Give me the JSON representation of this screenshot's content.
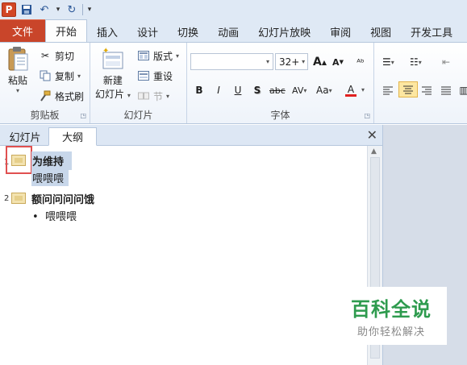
{
  "quick_access": {
    "logo": "P"
  },
  "tabs": {
    "file": "文件",
    "items": [
      "开始",
      "插入",
      "设计",
      "切换",
      "动画",
      "幻灯片放映",
      "审阅",
      "视图",
      "开发工具"
    ]
  },
  "ribbon": {
    "clipboard": {
      "label": "剪贴板",
      "paste": "粘贴",
      "cut": "剪切",
      "copy": "复制",
      "format_painter": "格式刷"
    },
    "slides": {
      "label": "幻灯片",
      "new_slide_line1": "新建",
      "new_slide_line2": "幻灯片",
      "layout": "版式",
      "reset": "重设",
      "section": "节"
    },
    "font": {
      "label": "字体",
      "font_name": "",
      "font_size": "32+",
      "bold": "B",
      "italic": "I",
      "underline": "U",
      "shadow": "S",
      "strike": "abc",
      "spacing": "AV",
      "case": "Aa",
      "color": "A",
      "grow": "A",
      "shrink": "A"
    }
  },
  "pane": {
    "tab_slides": "幻灯片",
    "tab_outline": "大纲",
    "close": "✕"
  },
  "outline": {
    "slides": [
      {
        "num": "1",
        "title": "为维持",
        "bullets": [
          "喂喂喂"
        ]
      },
      {
        "num": "2",
        "title": "额问问问问饿",
        "bullets": [
          "喂喂喂"
        ]
      }
    ]
  },
  "watermark": {
    "title": "百科全说",
    "subtitle": "助你轻松解决"
  },
  "colors": {
    "file_tab": "#c9452a",
    "ribbon_bg": "#dfe9f5",
    "highlight": "#fde7a1",
    "selection_box": "#e05050",
    "watermark_green": "#2e9b4e"
  }
}
